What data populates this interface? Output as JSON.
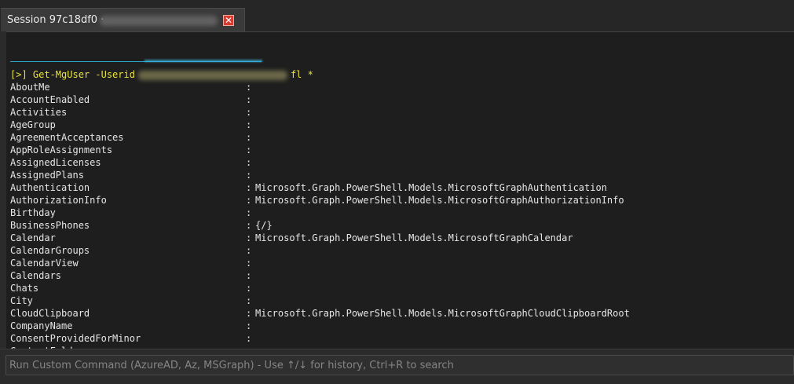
{
  "tab": {
    "title": "Session 97c18df0 ·",
    "close_glyph": "✕"
  },
  "console": {
    "command": {
      "prefix": "[>] Get-MgUser -Userid",
      "suffix": "fl *"
    },
    "rows": [
      {
        "name": "AboutMe",
        "value": ""
      },
      {
        "name": "AccountEnabled",
        "value": ""
      },
      {
        "name": "Activities",
        "value": ""
      },
      {
        "name": "AgeGroup",
        "value": ""
      },
      {
        "name": "AgreementAcceptances",
        "value": ""
      },
      {
        "name": "AppRoleAssignments",
        "value": ""
      },
      {
        "name": "AssignedLicenses",
        "value": ""
      },
      {
        "name": "AssignedPlans",
        "value": ""
      },
      {
        "name": "Authentication",
        "value": "Microsoft.Graph.PowerShell.Models.MicrosoftGraphAuthentication"
      },
      {
        "name": "AuthorizationInfo",
        "value": "Microsoft.Graph.PowerShell.Models.MicrosoftGraphAuthorizationInfo"
      },
      {
        "name": "Birthday",
        "value": ""
      },
      {
        "name": "BusinessPhones",
        "value": "{/}"
      },
      {
        "name": "Calendar",
        "value": "Microsoft.Graph.PowerShell.Models.MicrosoftGraphCalendar"
      },
      {
        "name": "CalendarGroups",
        "value": ""
      },
      {
        "name": "CalendarView",
        "value": ""
      },
      {
        "name": "Calendars",
        "value": ""
      },
      {
        "name": "Chats",
        "value": ""
      },
      {
        "name": "City",
        "value": ""
      },
      {
        "name": "CloudClipboard",
        "value": "Microsoft.Graph.PowerShell.Models.MicrosoftGraphCloudClipboardRoot"
      },
      {
        "name": "CompanyName",
        "value": ""
      },
      {
        "name": "ConsentProvidedForMinor",
        "value": ""
      },
      {
        "name": "ContactFolders",
        "value": ""
      }
    ]
  },
  "input": {
    "placeholder": "Run Custom Command (AzureAD, Az, MSGraph) - Use ↑/↓ for history, Ctrl+R to search"
  }
}
